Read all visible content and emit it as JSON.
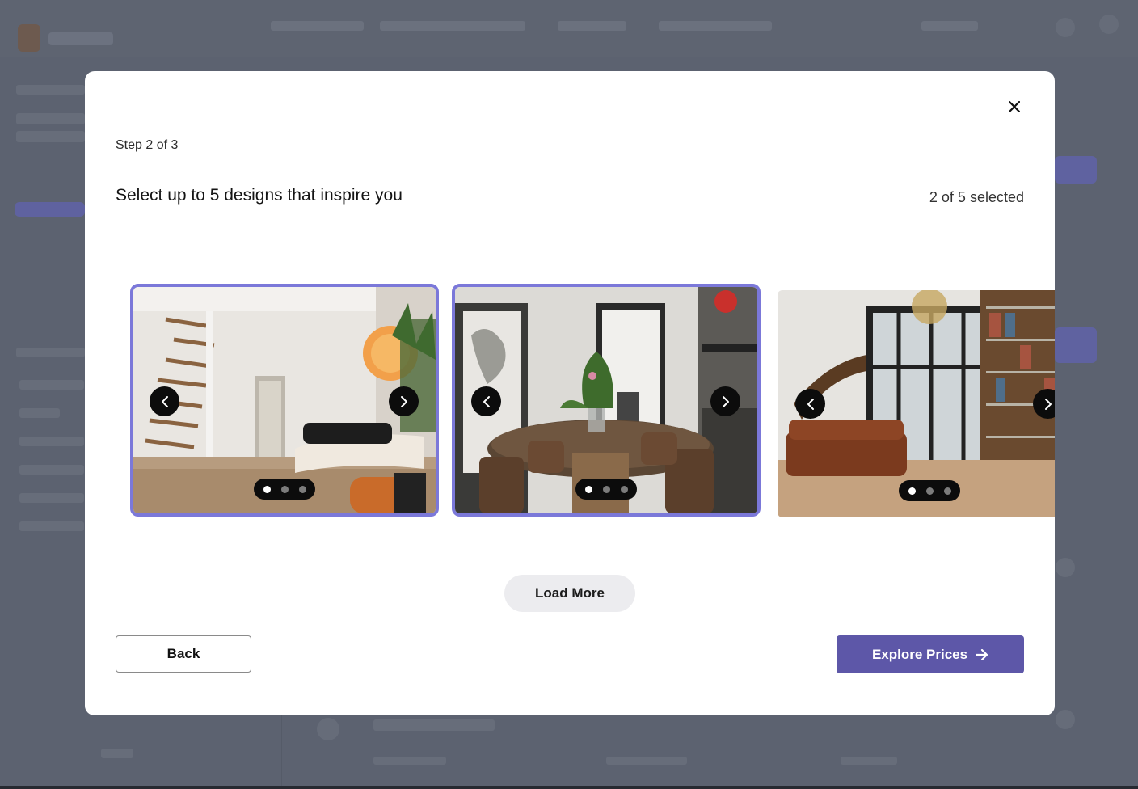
{
  "modal": {
    "step_label": "Step 2 of 3",
    "heading": "Select up to 5 designs that inspire you",
    "selection_count": "2 of 5 selected",
    "load_more_label": "Load More",
    "back_label": "Back",
    "explore_label": "Explore Prices",
    "accent_color": "#5d57a8",
    "selected_border_color": "#7b78d9"
  },
  "designs": [
    {
      "name": "living-room-spiral-staircase",
      "selected": true,
      "active_slide": 1,
      "slide_count": 3
    },
    {
      "name": "dining-room-oval-table",
      "selected": true,
      "active_slide": 1,
      "slide_count": 3
    },
    {
      "name": "double-height-library-lounge",
      "selected": false,
      "active_slide": 1,
      "slide_count": 3
    }
  ],
  "icons": {
    "close": "close-icon",
    "prev": "chevron-left-icon",
    "next": "chevron-right-icon",
    "arrow": "arrow-right-icon"
  }
}
